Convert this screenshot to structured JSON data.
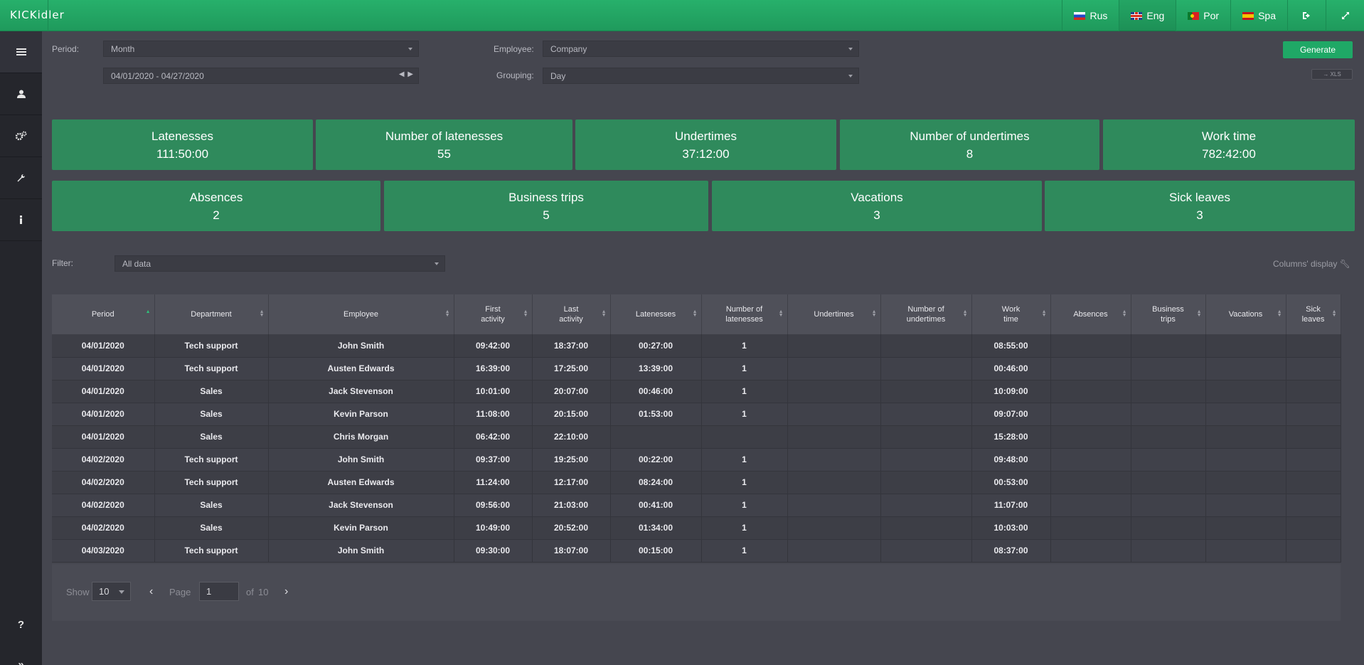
{
  "app": {
    "logo": "KICKidler"
  },
  "topbar": {
    "languages": [
      {
        "label": "Rus",
        "flag": "ru"
      },
      {
        "label": "Eng",
        "flag": "en"
      },
      {
        "label": "Por",
        "flag": "pt"
      },
      {
        "label": "Spa",
        "flag": "es"
      }
    ],
    "icons": [
      "logout-icon",
      "fullscreen-icon"
    ]
  },
  "sidebar": {
    "items": [
      "menu-icon",
      "user-icon",
      "settings-icon",
      "wrench-icon",
      "info-icon"
    ],
    "bottom": [
      "help-icon",
      "expand-icon"
    ]
  },
  "form": {
    "period_label": "Period:",
    "period_value": "Month",
    "date_range": "04/01/2020 - 04/27/2020",
    "employee_label": "Employee:",
    "employee_value": "Company",
    "grouping_label": "Grouping:",
    "grouping_value": "Day",
    "generate_label": "Generate",
    "xls_label": "→ XLS"
  },
  "summary_row1": [
    {
      "title": "Latenesses",
      "value": "111:50:00"
    },
    {
      "title": "Number of latenesses",
      "value": "55"
    },
    {
      "title": "Undertimes",
      "value": "37:12:00"
    },
    {
      "title": "Number of undertimes",
      "value": "8"
    },
    {
      "title": "Work time",
      "value": "782:42:00"
    }
  ],
  "summary_row2": [
    {
      "title": "Absences",
      "value": "2"
    },
    {
      "title": "Business trips",
      "value": "5"
    },
    {
      "title": "Vacations",
      "value": "3"
    },
    {
      "title": "Sick leaves",
      "value": "3"
    }
  ],
  "filter": {
    "label": "Filter:",
    "value": "All data",
    "columns_display": "Columns' display"
  },
  "table": {
    "columns": [
      [
        "Period"
      ],
      [
        "Department"
      ],
      [
        "Employee"
      ],
      [
        "First",
        "activity"
      ],
      [
        "Last",
        "activity"
      ],
      [
        "Latenesses"
      ],
      [
        "Number of",
        "latenesses"
      ],
      [
        "Undertimes"
      ],
      [
        "Number of",
        "undertimes"
      ],
      [
        "Work",
        "time"
      ],
      [
        "Absences"
      ],
      [
        "Business",
        "trips"
      ],
      [
        "Vacations"
      ],
      [
        "Sick",
        "leaves"
      ]
    ],
    "rows": [
      [
        "04/01/2020",
        "Tech support",
        "John Smith",
        "09:42:00",
        "18:37:00",
        "00:27:00",
        "1",
        "",
        "",
        "08:55:00",
        "",
        "",
        "",
        ""
      ],
      [
        "04/01/2020",
        "Tech support",
        "Austen Edwards",
        "16:39:00",
        "17:25:00",
        "13:39:00",
        "1",
        "",
        "",
        "00:46:00",
        "",
        "",
        "",
        ""
      ],
      [
        "04/01/2020",
        "Sales",
        "Jack Stevenson",
        "10:01:00",
        "20:07:00",
        "00:46:00",
        "1",
        "",
        "",
        "10:09:00",
        "",
        "",
        "",
        ""
      ],
      [
        "04/01/2020",
        "Sales",
        "Kevin Parson",
        "11:08:00",
        "20:15:00",
        "01:53:00",
        "1",
        "",
        "",
        "09:07:00",
        "",
        "",
        "",
        ""
      ],
      [
        "04/01/2020",
        "Sales",
        "Chris Morgan",
        "06:42:00",
        "22:10:00",
        "",
        "",
        "",
        "",
        "15:28:00",
        "",
        "",
        "",
        ""
      ],
      [
        "04/02/2020",
        "Tech support",
        "John Smith",
        "09:37:00",
        "19:25:00",
        "00:22:00",
        "1",
        "",
        "",
        "09:48:00",
        "",
        "",
        "",
        ""
      ],
      [
        "04/02/2020",
        "Tech support",
        "Austen Edwards",
        "11:24:00",
        "12:17:00",
        "08:24:00",
        "1",
        "",
        "",
        "00:53:00",
        "",
        "",
        "",
        ""
      ],
      [
        "04/02/2020",
        "Sales",
        "Jack Stevenson",
        "09:56:00",
        "21:03:00",
        "00:41:00",
        "1",
        "",
        "",
        "11:07:00",
        "",
        "",
        "",
        ""
      ],
      [
        "04/02/2020",
        "Sales",
        "Kevin Parson",
        "10:49:00",
        "20:52:00",
        "01:34:00",
        "1",
        "",
        "",
        "10:03:00",
        "",
        "",
        "",
        ""
      ],
      [
        "04/03/2020",
        "Tech support",
        "John Smith",
        "09:30:00",
        "18:07:00",
        "00:15:00",
        "1",
        "",
        "",
        "08:37:00",
        "",
        "",
        "",
        ""
      ]
    ]
  },
  "pager": {
    "show_label": "Show",
    "show_value": "10",
    "page_label": "Page",
    "page_value": "1",
    "of_label": "of",
    "total_pages": "10"
  }
}
